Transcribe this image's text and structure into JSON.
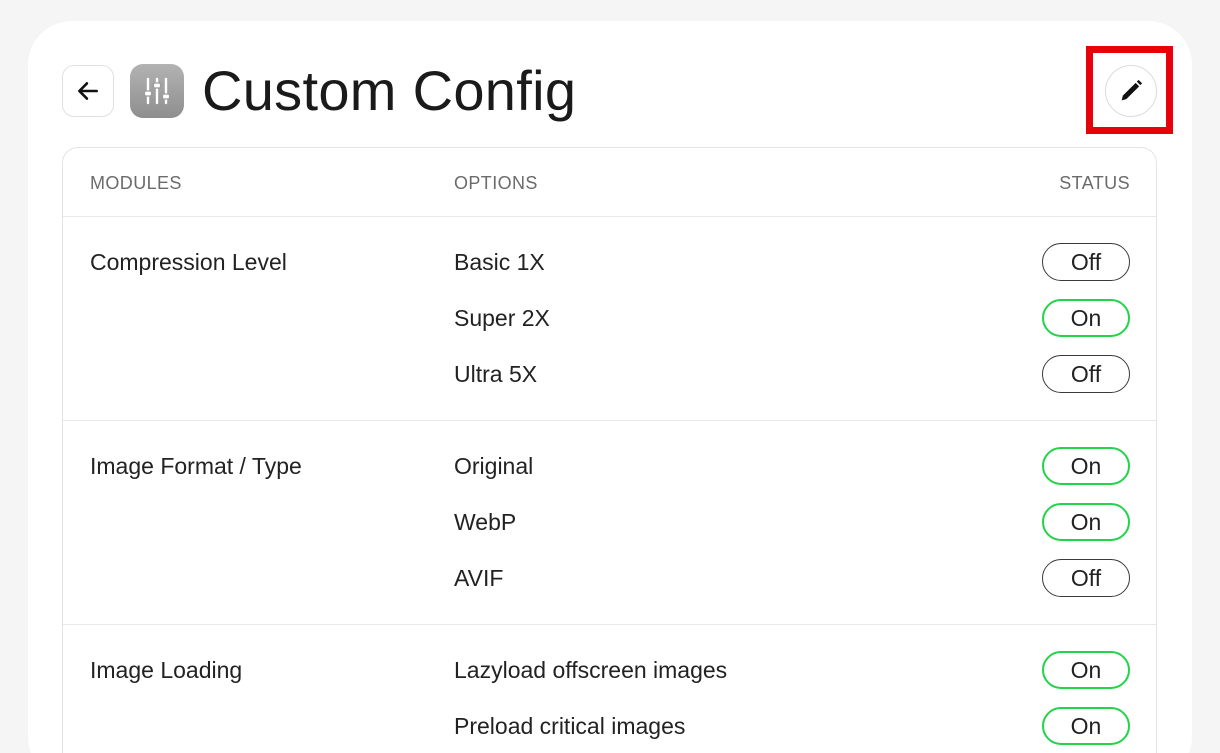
{
  "header": {
    "title": "Custom Config",
    "back_icon": "arrow-left-icon",
    "app_icon": "sliders-icon",
    "edit_icon": "pencil-icon"
  },
  "colors": {
    "on_border": "#22d44a",
    "off_border": "#3a3a3a",
    "highlight": "#e8000b"
  },
  "table": {
    "columns": {
      "modules": "MODULES",
      "options": "OPTIONS",
      "status": "STATUS"
    },
    "groups": [
      {
        "module": "Compression Level",
        "options": [
          {
            "label": "Basic 1X",
            "status": "Off"
          },
          {
            "label": "Super 2X",
            "status": "On"
          },
          {
            "label": "Ultra 5X",
            "status": "Off"
          }
        ]
      },
      {
        "module": "Image Format / Type",
        "options": [
          {
            "label": "Original",
            "status": "On"
          },
          {
            "label": "WebP",
            "status": "On"
          },
          {
            "label": "AVIF",
            "status": "Off"
          }
        ]
      },
      {
        "module": "Image Loading",
        "options": [
          {
            "label": "Lazyload offscreen images",
            "status": "On"
          },
          {
            "label": "Preload critical images",
            "status": "On"
          }
        ]
      }
    ]
  }
}
